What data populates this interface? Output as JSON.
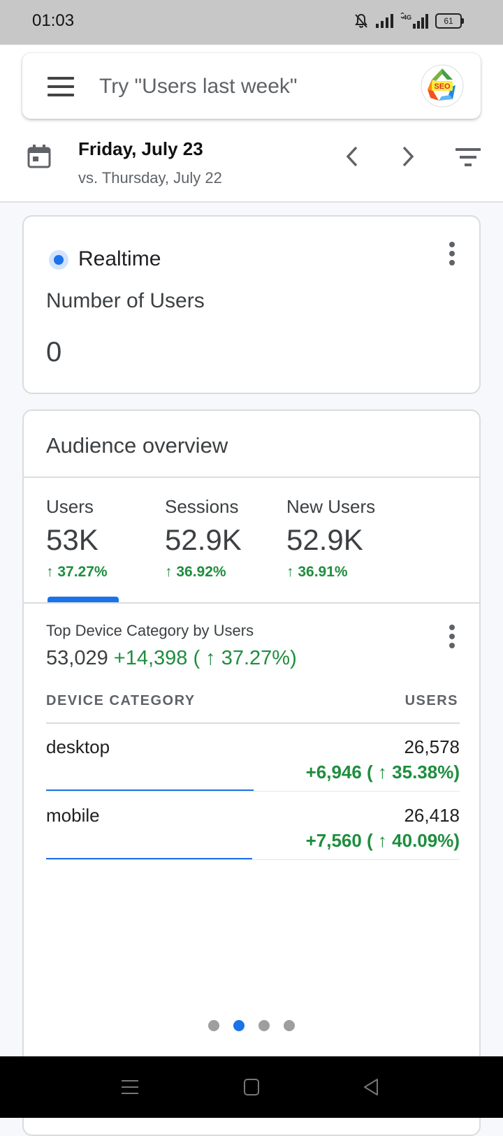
{
  "status_bar": {
    "time": "01:03",
    "battery": "61",
    "icons": [
      "mute-bell-icon",
      "signal-icon",
      "4g-signal-icon",
      "battery-icon"
    ]
  },
  "search": {
    "placeholder": "Try \"Users last week\"",
    "menu_icon": "menu-icon",
    "logo_text": "SEO"
  },
  "date": {
    "main": "Friday, July 23",
    "compare": "vs. Thursday, July 22",
    "icons": [
      "calendar-icon",
      "chevron-left-icon",
      "chevron-right-icon",
      "filter-icon"
    ]
  },
  "realtime": {
    "label": "Realtime",
    "metric": "Number of Users",
    "value": "0"
  },
  "audience": {
    "title": "Audience overview",
    "metrics": [
      {
        "label": "Users",
        "value": "53K",
        "change": "↑ 37.27%"
      },
      {
        "label": "Sessions",
        "value": "52.9K",
        "change": "↑ 36.92%"
      },
      {
        "label": "New Users",
        "value": "52.9K",
        "change": "↑ 36.91%"
      }
    ],
    "top_device": {
      "title": "Top Device Category by Users",
      "total": "53,029",
      "delta": "+14,398 ( ↑ 37.27%)"
    },
    "table": {
      "col_left": "DEVICE CATEGORY",
      "col_right": "USERS",
      "rows": [
        {
          "name": "desktop",
          "value": "26,578",
          "change": "+6,946 ( ↑ 35.38%)",
          "share": 0.501
        },
        {
          "name": "mobile",
          "value": "26,418",
          "change": "+7,560 ( ↑ 40.09%)",
          "share": 0.498
        }
      ]
    },
    "pager": {
      "count": 4,
      "active": 1
    }
  },
  "colors": {
    "accent": "#1a73e8",
    "positive": "#1e8e3e",
    "status_bar": "#c7c7c7"
  }
}
